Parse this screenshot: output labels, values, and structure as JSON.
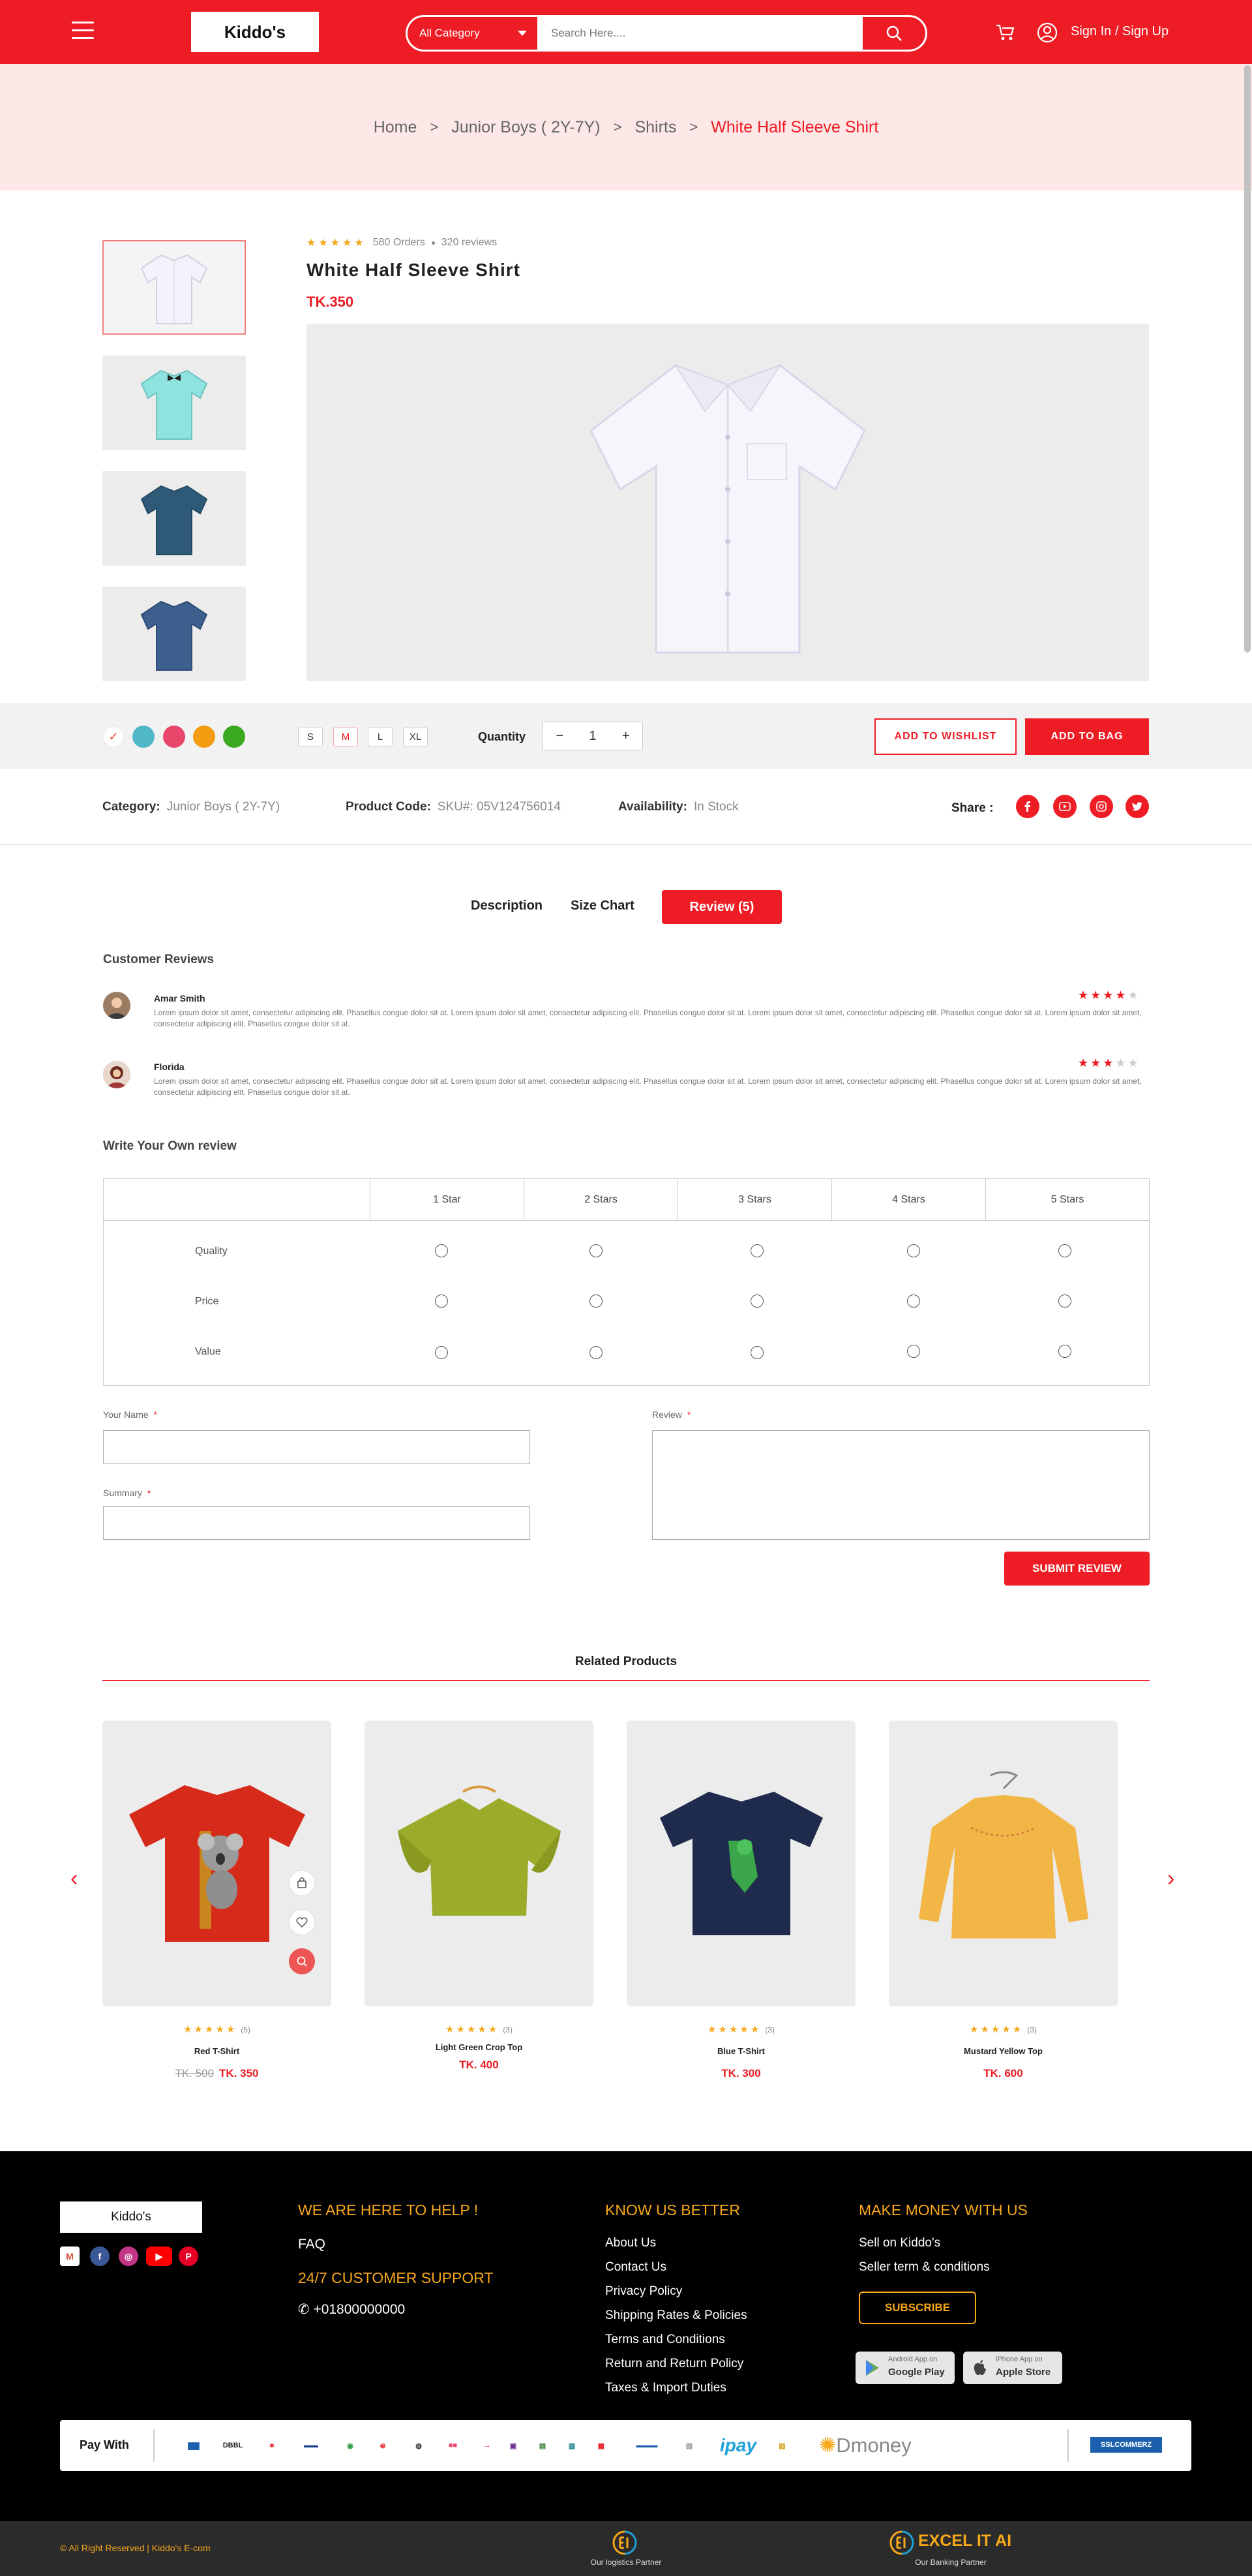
{
  "header": {
    "logo": "Kiddo's",
    "category": "All Category",
    "search_placeholder": "Search Here....",
    "signin": "Sign In / Sign Up"
  },
  "breadcrumb": {
    "home": "Home",
    "level1": "Junior Boys ( 2Y-7Y)",
    "level2": "Shirts",
    "current": "White Half Sleeve Shirt"
  },
  "product": {
    "stars": "★★★★★",
    "orders": "580 Orders",
    "reviews": "320 reviews",
    "title": "White Half Sleeve Shirt",
    "price": "TK.350",
    "colors": [
      "#e74c3c",
      "#4fb7c7",
      "#e8476b",
      "#f39c12",
      "#3aa91f"
    ],
    "sizes": [
      "S",
      "M",
      "L",
      "XL"
    ],
    "quantity_label": "Quantity",
    "quantity": "1",
    "minus": "−",
    "plus": "+",
    "wishlist_btn": "ADD TO WISHLIST",
    "bag_btn": "ADD TO BAG",
    "category_label": "Category:",
    "category": "Junior Boys ( 2Y-7Y)",
    "code_label": "Product Code:",
    "code": "SKU#: 05V124756014",
    "availability_label": "Availability:",
    "availability": "In Stock",
    "share_label": "Share :"
  },
  "tabs": {
    "description": "Description",
    "size_chart": "Size Chart",
    "review": "Review (5)"
  },
  "reviews": {
    "heading": "Customer Reviews",
    "items": [
      {
        "name": "Amar Smith",
        "text": "Lorem ipsum dolor sit amet, consectetur adipiscing elit. Phasellus congue dolor sit at. Lorem ipsum dolor sit amet, consectetur adipiscing elit. Phasellus congue dolor sit at. Lorem ipsum dolor sit amet, consectetur adipiscing elit. Phasellus congue dolor sit at. Lorem ipsum dolor sit amet, consectetur adipiscing elit. Phasellus congue dolor sit at.",
        "rating": 4
      },
      {
        "name": "Florida",
        "text": "Lorem ipsum dolor sit amet, consectetur adipiscing elit. Phasellus congue dolor sit at. Lorem ipsum dolor sit amet, consectetur adipiscing elit. Phasellus congue dolor sit at. Lorem ipsum dolor sit amet, consectetur adipiscing elit. Phasellus congue dolor sit at. Lorem ipsum dolor sit amet, consectetur adipiscing elit. Phasellus congue dolor sit at.",
        "rating": 3
      }
    ]
  },
  "write_review": {
    "heading": "Write Your Own review",
    "columns": [
      "1 Star",
      "2 Stars",
      "3 Stars",
      "4 Stars",
      "5 Stars"
    ],
    "rows": [
      "Quality",
      "Price",
      "Value"
    ],
    "name_label": "Your Name",
    "summary_label": "Summary",
    "review_label": "Review",
    "required": "*",
    "submit": "SUBMIT REVIEW"
  },
  "related": {
    "heading": "Related Products",
    "items": [
      {
        "name": "Red T-Shirt",
        "count": "(5)",
        "old_price": "TK. 500",
        "price": "TK. 350",
        "stars": "★★★★★"
      },
      {
        "name": "Light Green Crop Top",
        "count": "(3)",
        "old_price": "",
        "price": "TK. 400",
        "stars": "★★★★★"
      },
      {
        "name": "Blue T-Shirt",
        "count": "(3)",
        "old_price": "",
        "price": "TK. 300",
        "stars": "★★★★★"
      },
      {
        "name": "Mustard Yellow Top",
        "count": "(3)",
        "old_price": "",
        "price": "TK. 600",
        "stars": "★★★★★"
      }
    ]
  },
  "footer": {
    "logo": "Kiddo's",
    "help_heading": "WE ARE HERE TO HELP !",
    "faq": "FAQ",
    "support_heading": "24/7 CUSTOMER SUPPORT",
    "phone": "+01800000000",
    "know_heading": "KNOW US BETTER",
    "know_links": [
      "About Us",
      "Contact Us",
      "Privacy Policy",
      "Shipping Rates & Policies",
      "Terms and Conditions",
      "Return and Return Policy",
      "Taxes & Import Duties"
    ],
    "money_heading": "MAKE MONEY WITH US",
    "money_links": [
      "Sell on Kiddo's",
      "Seller term & conditions"
    ],
    "subscribe": "SUBSCRIBE",
    "android_small": "Android App on",
    "android_big": "Google Play",
    "ios_small": "iPhone App on",
    "ios_big": "Apple Store",
    "pay_with": "Pay With",
    "payments": [
      "ipay",
      "DBBL",
      "Dmoney",
      "SSLCOMMERZ"
    ],
    "copyright": "© All Right Reserved | Kiddo's E-com",
    "partner_brand": "EXCEL IT AI",
    "logistics_partner": "Our logistics Partner",
    "banking_partner": "Our Banking Partner"
  }
}
